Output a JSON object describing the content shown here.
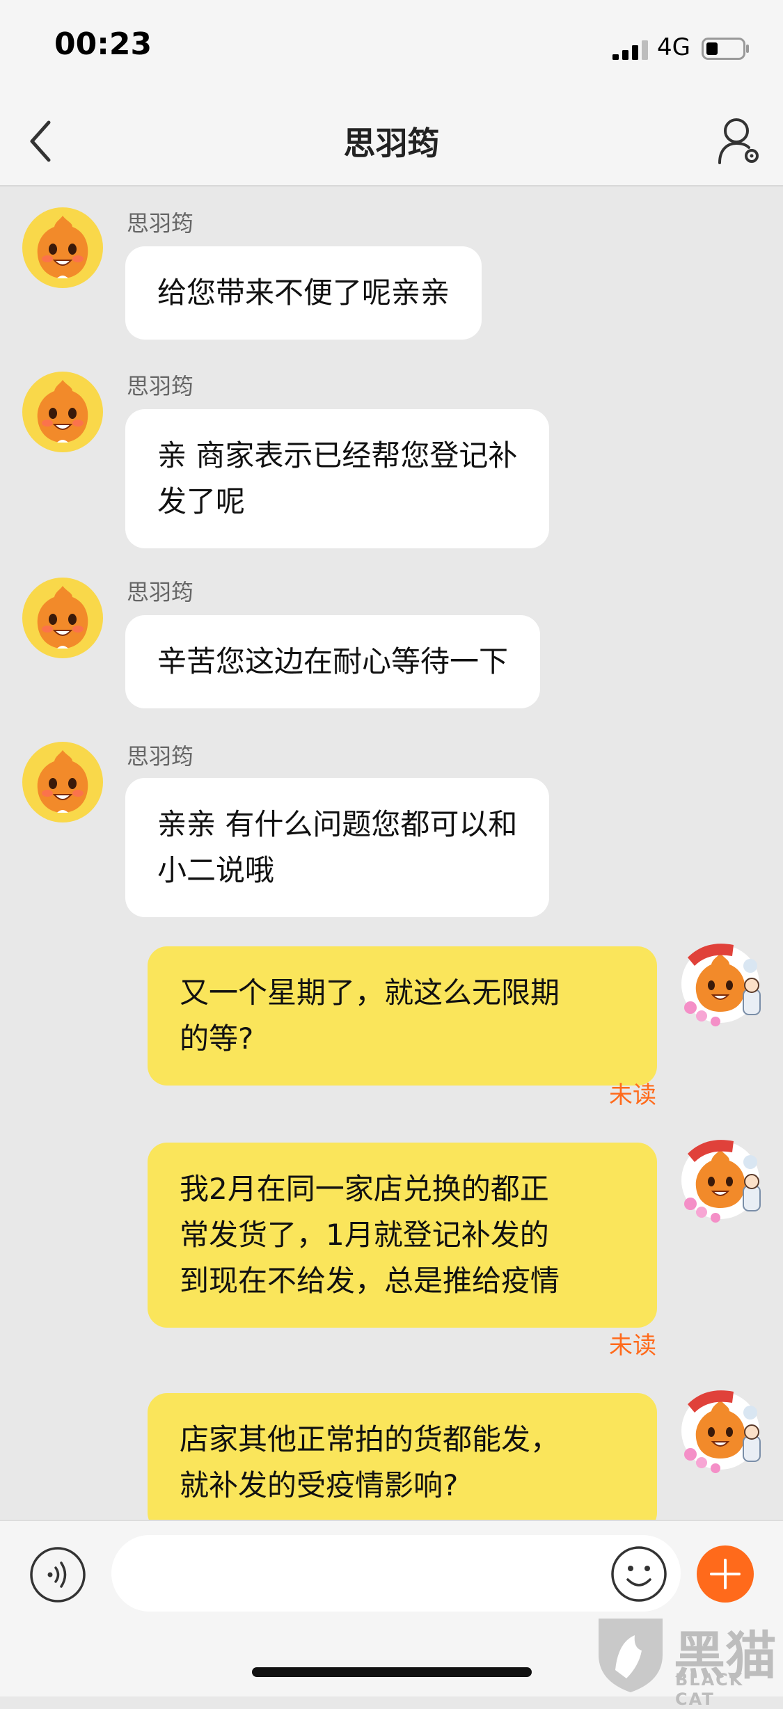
{
  "status_bar": {
    "time": "00:23",
    "network": "4G"
  },
  "header": {
    "title": "思羽筠"
  },
  "messages": [
    {
      "sender": "思羽筠",
      "lines": [
        "给您带来不便了呢亲亲"
      ]
    },
    {
      "sender": "思羽筠",
      "lines": [
        "亲   商家表示已经帮您登记补",
        "发了呢"
      ]
    },
    {
      "sender": "思羽筠",
      "lines": [
        "辛苦您这边在耐心等待一下"
      ]
    },
    {
      "sender": "思羽筠",
      "lines": [
        "亲亲   有什么问题您都可以和",
        "小二说哦"
      ]
    },
    {
      "lines": [
        "又一个星期了，就这么无限期",
        "的等?"
      ],
      "status": "未读"
    },
    {
      "lines": [
        "我2月在同一家店兑换的都正",
        "常发货了，1月就登记补发的",
        "到现在不给发，总是推给疫情"
      ],
      "status": "未读"
    },
    {
      "lines": [
        "店家其他正常拍的货都能发，",
        "就补发的受疫情影响?"
      ]
    }
  ],
  "input_bar": {
    "placeholder": ""
  },
  "watermark": {
    "text": "黑猫",
    "subtext": "BLACK CAT"
  },
  "colors": {
    "outgoing_bubble": "#fae55b",
    "incoming_bubble": "#ffffff",
    "unread": "#ff6a1b",
    "plus_button": "#ff6a1b"
  }
}
